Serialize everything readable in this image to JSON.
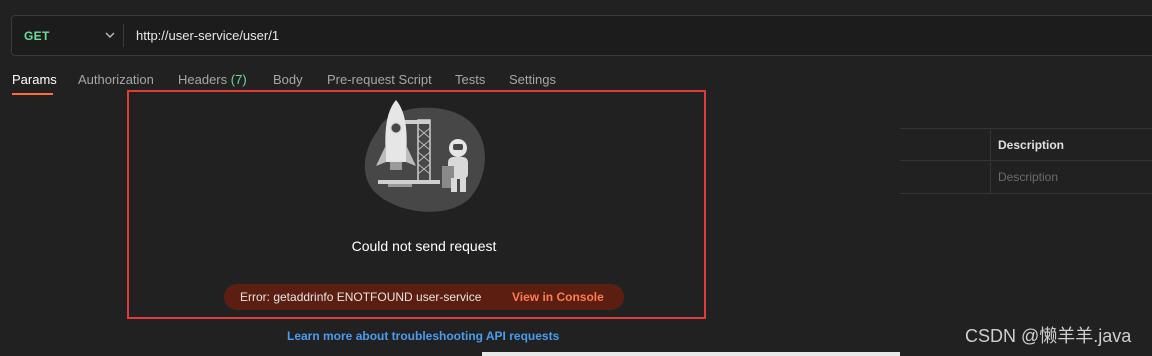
{
  "request": {
    "method": "GET",
    "url": "http://user-service/user/1"
  },
  "tabs": [
    {
      "label": "Params"
    },
    {
      "label": "Authorization"
    },
    {
      "label": "Headers",
      "count": "(7)"
    },
    {
      "label": "Body"
    },
    {
      "label": "Pre-request Script"
    },
    {
      "label": "Tests"
    },
    {
      "label": "Settings"
    }
  ],
  "table": {
    "description_header": "Description",
    "description_placeholder": "Description"
  },
  "error": {
    "title": "Could not send request",
    "message": "Error: getaddrinfo ENOTFOUND user-service",
    "console_link": "View in Console",
    "learn_more": "Learn more about troubleshooting API requests"
  },
  "watermark": "CSDN @懒羊羊.java",
  "colors": {
    "method": "#6bdd9a",
    "active_tab_underline": "#ff6c37",
    "error_pill": "#5b1e10",
    "console_link": "#ff7b52",
    "learn_more": "#4a9cf0",
    "highlight_border": "#e03b3b"
  }
}
